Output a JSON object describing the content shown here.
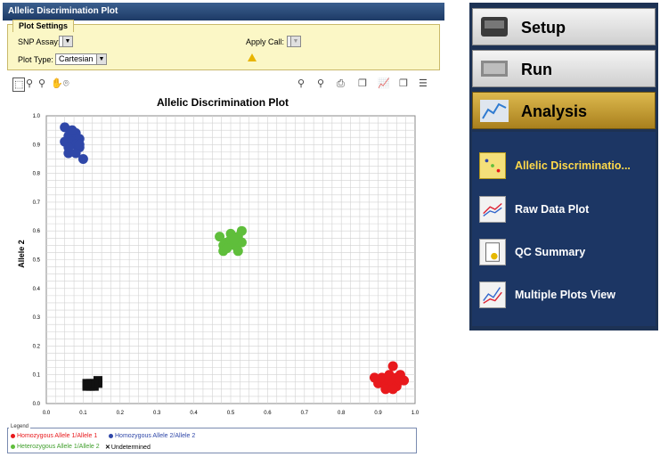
{
  "window": {
    "title": "Allelic Discrimination Plot"
  },
  "plot_settings": {
    "tab_label": "Plot Settings",
    "snp_assay_label": "SNP Assay:",
    "snp_assay_value": "",
    "apply_call_label": "Apply Call:",
    "plot_type_label": "Plot Type:",
    "plot_type_value": "Cartesian"
  },
  "chart_data": {
    "type": "scatter",
    "title": "Allelic Discrimination Plot",
    "xlabel": "",
    "ylabel": "Allele 2",
    "xlim": [
      0,
      1.0
    ],
    "ylim": [
      0,
      1.0
    ],
    "xticks": [
      "0.0",
      "0.1",
      "0.2",
      "0.3",
      "0.4",
      "0.5",
      "0.6",
      "0.7",
      "0.8",
      "0.9",
      "1.0"
    ],
    "yticks": [
      "0.0",
      "0.1",
      "0.2",
      "0.3",
      "0.4",
      "0.5",
      "0.6",
      "0.7",
      "0.8",
      "0.9",
      "1.0"
    ],
    "grid": true,
    "legend_title": "Legend",
    "series": [
      {
        "name": "Homozygous Allele 1/Allele 1",
        "color": "#e8191c",
        "marker": "circle",
        "points": [
          [
            0.9,
            0.07
          ],
          [
            0.91,
            0.09
          ],
          [
            0.92,
            0.06
          ],
          [
            0.93,
            0.08
          ],
          [
            0.93,
            0.1
          ],
          [
            0.94,
            0.13
          ],
          [
            0.94,
            0.07
          ],
          [
            0.95,
            0.09
          ],
          [
            0.95,
            0.06
          ],
          [
            0.96,
            0.1
          ],
          [
            0.96,
            0.08
          ],
          [
            0.97,
            0.08
          ],
          [
            0.92,
            0.05
          ],
          [
            0.94,
            0.05
          ],
          [
            0.89,
            0.09
          ]
        ]
      },
      {
        "name": "Homozygous Allele 2/Allele 2",
        "color": "#2f47a8",
        "marker": "circle",
        "points": [
          [
            0.05,
            0.96
          ],
          [
            0.06,
            0.93
          ],
          [
            0.05,
            0.91
          ],
          [
            0.07,
            0.91
          ],
          [
            0.08,
            0.94
          ],
          [
            0.09,
            0.92
          ],
          [
            0.08,
            0.9
          ],
          [
            0.09,
            0.89
          ],
          [
            0.06,
            0.87
          ],
          [
            0.08,
            0.87
          ],
          [
            0.1,
            0.85
          ],
          [
            0.07,
            0.95
          ],
          [
            0.09,
            0.9
          ],
          [
            0.06,
            0.89
          ]
        ]
      },
      {
        "name": "Heterozygous Allele 1/Allele 2",
        "color": "#5fbe3b",
        "marker": "circle",
        "points": [
          [
            0.47,
            0.58
          ],
          [
            0.48,
            0.55
          ],
          [
            0.48,
            0.53
          ],
          [
            0.49,
            0.56
          ],
          [
            0.5,
            0.59
          ],
          [
            0.5,
            0.57
          ],
          [
            0.51,
            0.55
          ],
          [
            0.52,
            0.53
          ],
          [
            0.52,
            0.58
          ],
          [
            0.53,
            0.6
          ],
          [
            0.53,
            0.56
          ],
          [
            0.49,
            0.54
          ],
          [
            0.51,
            0.57
          ]
        ]
      },
      {
        "name": "Undetermined",
        "color": "#111111",
        "marker": "square",
        "points": [
          [
            0.11,
            0.06
          ],
          [
            0.12,
            0.06
          ],
          [
            0.13,
            0.06
          ],
          [
            0.14,
            0.07
          ],
          [
            0.14,
            0.08
          ],
          [
            0.13,
            0.07
          ],
          [
            0.12,
            0.07
          ],
          [
            0.11,
            0.07
          ]
        ]
      }
    ]
  },
  "nav": {
    "setup_label": "Setup",
    "run_label": "Run",
    "analysis_label": "Analysis",
    "items": [
      {
        "label": "Allelic Discriminatio..."
      },
      {
        "label": "Raw Data Plot"
      },
      {
        "label": "QC Summary"
      },
      {
        "label": "Multiple Plots View"
      }
    ]
  },
  "colors": {
    "nav_background": "#1d3254",
    "active_tab": "#c9a23a",
    "selected_item_text": "#ffd94a",
    "panel_yellow": "#fbf7c6"
  }
}
